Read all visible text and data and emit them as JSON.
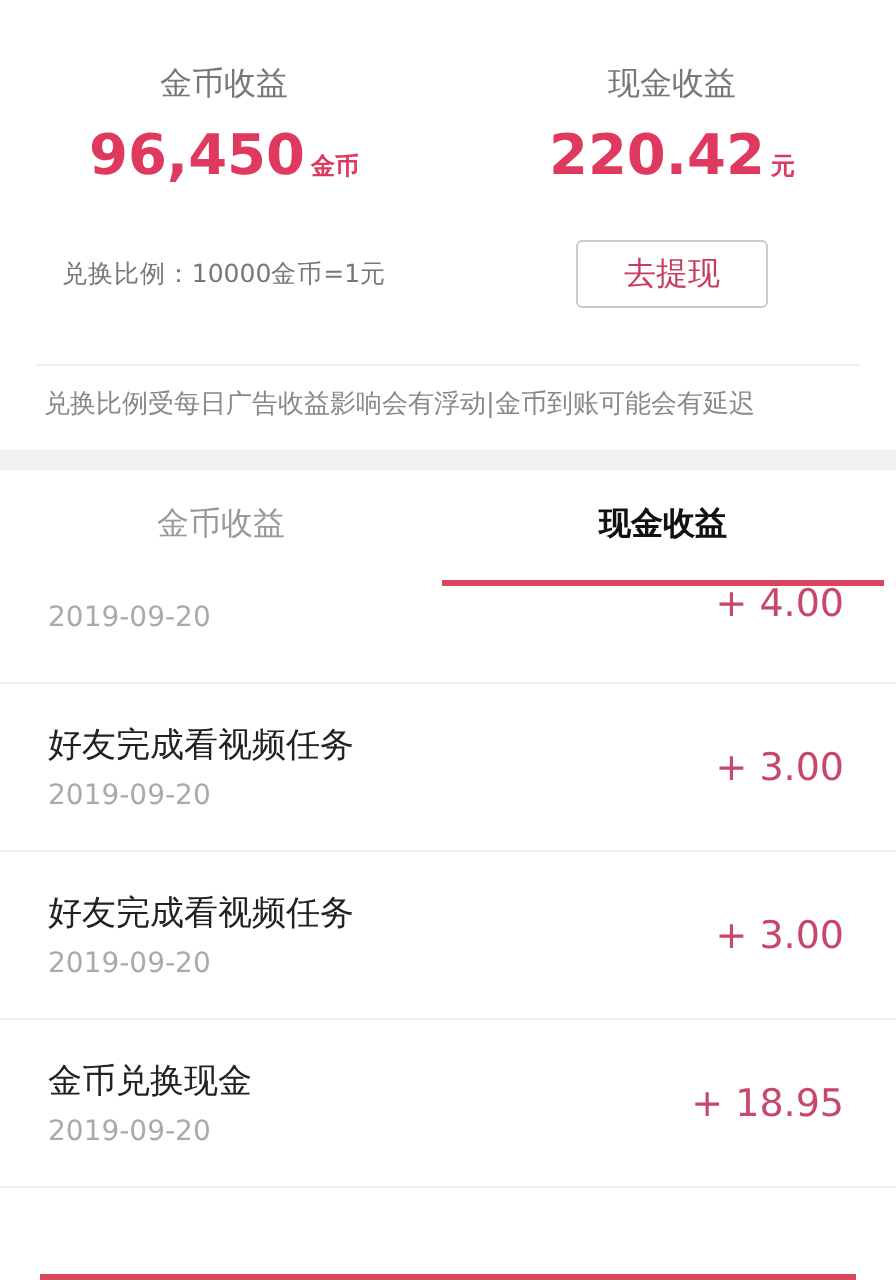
{
  "summary": [
    {
      "label": "金币收益",
      "value": "96,450",
      "unit": "金币"
    },
    {
      "label": "现金收益",
      "value": "220.42",
      "unit": "元"
    }
  ],
  "rate": "兑换比例：10000金币=1元",
  "withdraw_button": "去提现",
  "notice": "兑换比例受每日广告收益影响会有浮动|金币到账可能会有延迟",
  "tabs": [
    {
      "label": "金币收益",
      "selected": false
    },
    {
      "label": "现金收益",
      "selected": true
    }
  ],
  "records": [
    {
      "date": "2019-09-20",
      "amount": "+ 4.00"
    },
    {
      "title": "好友完成看视频任务",
      "date": "2019-09-20",
      "amount": "+ 3.00"
    },
    {
      "title": "好友完成看视频任务",
      "date": "2019-09-20",
      "amount": "+ 3.00"
    },
    {
      "title": "金币兑换现金",
      "date": "2019-09-20",
      "amount": "+ 18.95"
    }
  ]
}
